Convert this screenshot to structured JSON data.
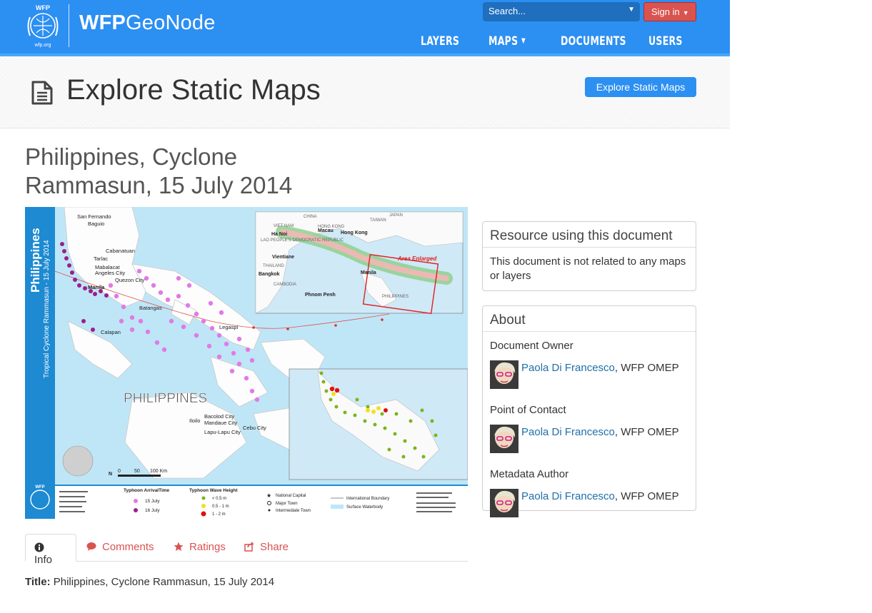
{
  "header": {
    "logo_text": "WFP",
    "logo_sub": "wfp.org",
    "brand_bold": "WFP",
    "brand_light": "GeoNode",
    "search_placeholder": "Search...",
    "signin_label": "Sign in",
    "nav": [
      "LAYERS",
      "MAPS",
      "DOCUMENTS",
      "USERS"
    ],
    "accent_color": "#2c8ff2",
    "signin_color": "#d9534f"
  },
  "page_header": {
    "title": "Explore Static Maps",
    "button_label": "Explore Static Maps"
  },
  "document": {
    "title": "Philippines, Cyclone Rammasun, 15 July 2014"
  },
  "map": {
    "country_label": "PHILIPPINES",
    "side_title": "Philippines",
    "side_subtitle": "Tropical Cyclone Rammasun - 15 July 2014",
    "inset_title": "Area Enlarged",
    "inset_labels": [
      "CHINA",
      "HONG KONG",
      "JAPAN",
      "TAIWAN",
      "VIET NAM",
      "LAO PEOPLE'S DEMOCRATIC REPUBLIC",
      "THAILAND",
      "CAMBODIA",
      "PHILIPPINES",
      "Ha Noi",
      "Macau",
      "Hong Kong",
      "Vientiane",
      "Bangkok",
      "Phnom Penh",
      "Manila"
    ],
    "places": [
      "San Fernando",
      "Baguio",
      "Cabanatuan",
      "Tarlac",
      "Mabalacat",
      "Angeles City",
      "Quezon City",
      "Manila",
      "Batangas",
      "Legaspi",
      "Calapan",
      "Iloilo",
      "Bacolod City",
      "Mandaue City",
      "Lapu-Lapu City",
      "Cebu City"
    ],
    "scale": [
      "0",
      "50",
      "100 Km"
    ],
    "legend": {
      "arrival_title": "Typhoon ArrivalTime",
      "arrival": [
        "15 July",
        "16 July"
      ],
      "wave_title": "Typhoon Wave Height",
      "wave": [
        "< 0.5 m",
        "0.5 - 1 m",
        "1 - 2 m"
      ],
      "symbols": [
        "National Capital",
        "Major Town",
        "Intermediate Town",
        "International Boundary",
        "Surface Waterbody"
      ]
    }
  },
  "tabs": [
    {
      "label": "Info",
      "icon": "info-icon"
    },
    {
      "label": "Comments",
      "icon": "comment-icon"
    },
    {
      "label": "Ratings",
      "icon": "star-icon"
    },
    {
      "label": "Share",
      "icon": "share-icon"
    }
  ],
  "info": {
    "title_key": "Title:",
    "title_value": "Philippines, Cyclone Rammasun, 15 July 2014"
  },
  "resource_panel": {
    "heading": "Resource using this document",
    "body": "This document is not related to any maps or layers"
  },
  "about_panel": {
    "heading": "About",
    "roles": [
      {
        "role": "Document Owner",
        "name": "Paola Di Francesco",
        "org": ", WFP OMEP"
      },
      {
        "role": "Point of Contact",
        "name": "Paola Di Francesco",
        "org": ", WFP OMEP"
      },
      {
        "role": "Metadata Author",
        "name": "Paola Di Francesco",
        "org": ", WFP OMEP"
      }
    ]
  }
}
